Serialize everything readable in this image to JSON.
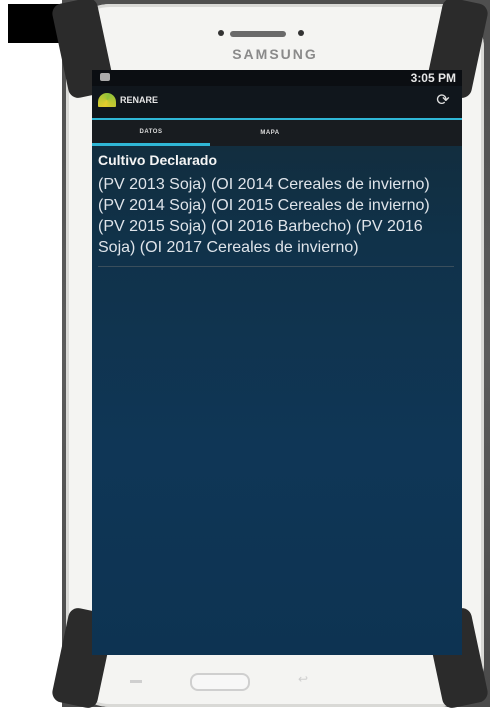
{
  "device": {
    "brand": "SAMSUNG"
  },
  "status_bar": {
    "time": "3:05 PM"
  },
  "app": {
    "title": "RENARE"
  },
  "tabs": [
    {
      "label": "DATOS",
      "active": true
    },
    {
      "label": "MAPA",
      "active": false
    }
  ],
  "section": {
    "title": "Cultivo Declarado",
    "body": "(PV 2013 Soja) (OI 2014 Cereales de invierno) (PV 2014 Soja) (OI 2015 Cereales de invierno) (PV 2015 Soja) (OI 2016 Barbecho) (PV 2016 Soja) (OI 2017 Cereales de invierno)"
  },
  "colors": {
    "accent": "#2fb7d6",
    "screen_bg": "#0f3656"
  }
}
